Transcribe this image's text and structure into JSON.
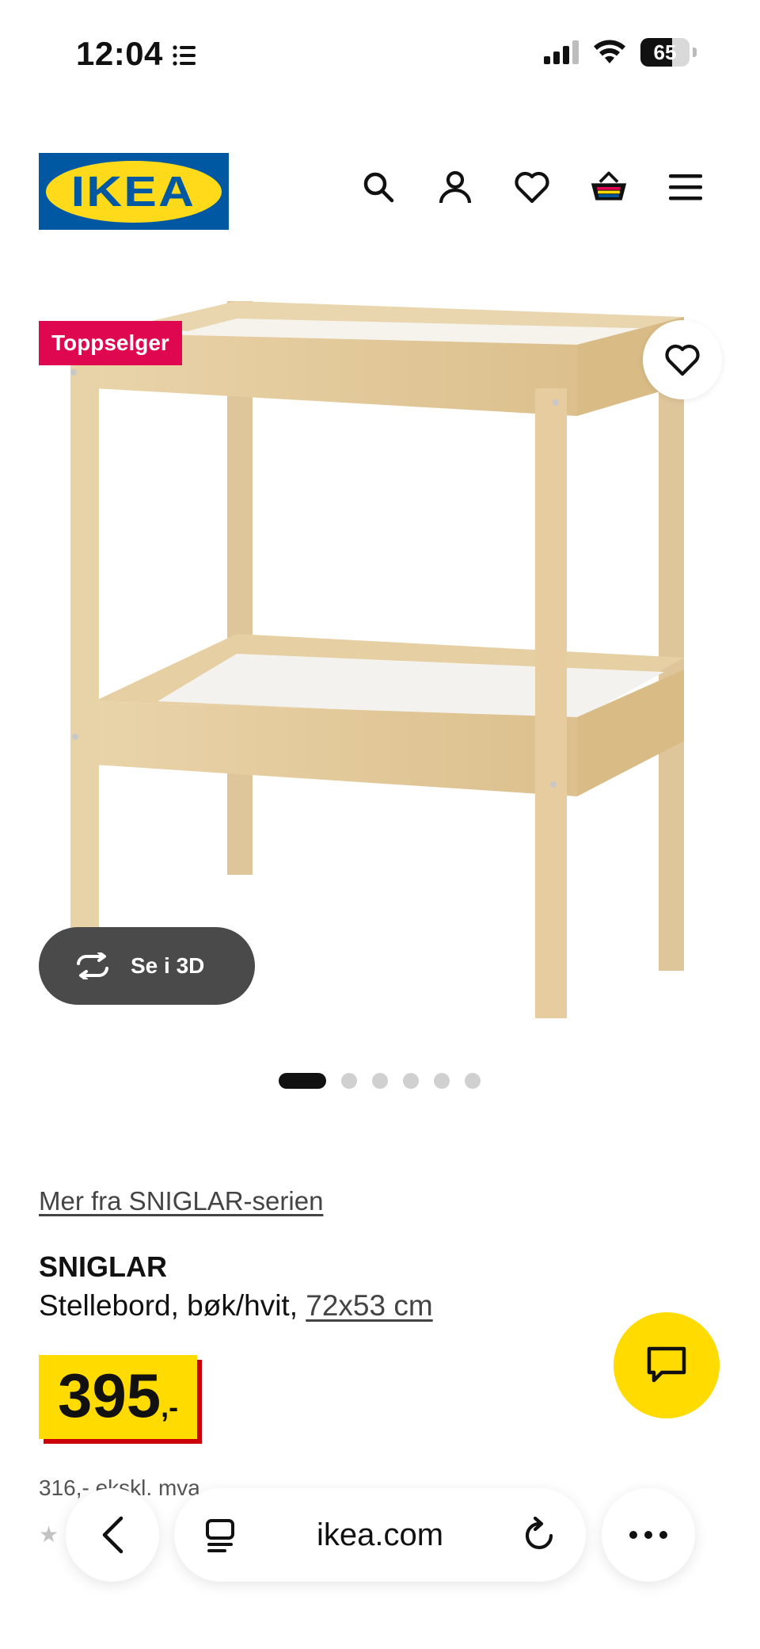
{
  "status_bar": {
    "time": "12:04",
    "battery": "65"
  },
  "header": {
    "logo_text": "IKEA",
    "icons": [
      "search-icon",
      "account-icon",
      "heart-icon",
      "basket-icon",
      "menu-icon"
    ]
  },
  "product_image": {
    "badge": "Toppselger",
    "view_3d_label": "Se i 3D",
    "carousel_total": 6,
    "carousel_active": 1
  },
  "product": {
    "series_link": "Mer fra SNIGLAR-serien",
    "name": "SNIGLAR",
    "description": "Stellebord, bøk/hvit, ",
    "dimensions": "72x53 cm",
    "price": "395",
    "price_suffix": ",-",
    "price_ex_vat": "316,- ekskl. mva"
  },
  "browser": {
    "url": "ikea.com"
  },
  "colors": {
    "ikea_blue": "#0058a3",
    "ikea_yellow": "#ffda1a",
    "badge_red": "#e00751",
    "price_yellow": "#ffdb00",
    "price_shadow": "#cc0008"
  }
}
